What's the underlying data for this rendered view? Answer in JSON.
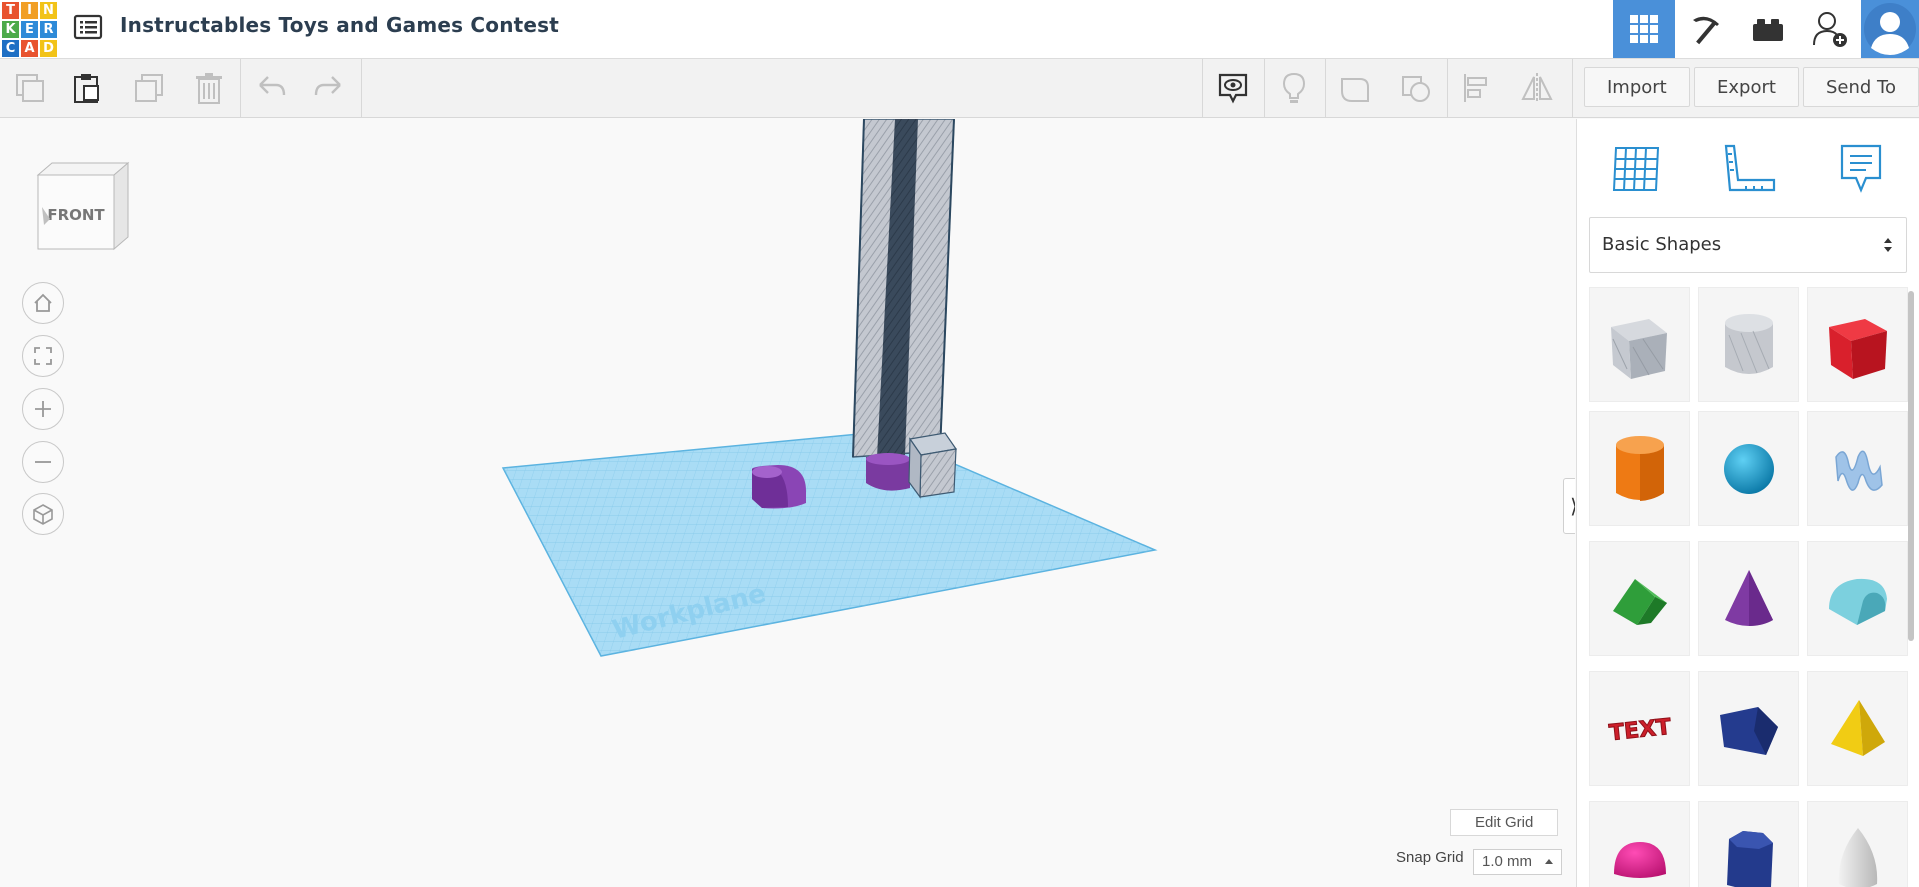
{
  "app": {
    "logo_letters": [
      "T",
      "I",
      "N",
      "K",
      "E",
      "R",
      "C",
      "A",
      "D"
    ],
    "logo_colors": [
      "#e8532f",
      "#f19f26",
      "#f2c318",
      "#4daa4a",
      "#2e8ad8",
      "#2e8ad8",
      "#1e6fc4",
      "#e8532f",
      "#f2c318"
    ],
    "design_title": "Instructables Toys and Games Contest"
  },
  "header": {
    "views": [
      {
        "name": "3d-design-view",
        "icon": "grid-icon",
        "active": true
      },
      {
        "name": "code-blocks-view",
        "icon": "pickaxe-icon",
        "active": false
      },
      {
        "name": "bricks-view",
        "icon": "bricks-icon",
        "active": false
      }
    ],
    "invite_icon": "add-user-icon",
    "accent": "#4a90d9"
  },
  "toolbar": {
    "import_label": "Import",
    "export_label": "Export",
    "send_to_label": "Send To"
  },
  "canvas": {
    "viewcube_label": "FRONT",
    "workplane_label": "Workplane",
    "edit_grid_label": "Edit Grid",
    "snap_grid_label": "Snap Grid",
    "snap_grid_value": "1.0 mm"
  },
  "panel": {
    "shape_category": "Basic Shapes",
    "shapes": [
      {
        "name": "box-hole",
        "color": "#b8bcc4"
      },
      {
        "name": "cylinder-hole",
        "color": "#c4c7cc"
      },
      {
        "name": "box",
        "color": "#d9202c"
      },
      {
        "name": "cylinder",
        "color": "#ee7a14"
      },
      {
        "name": "sphere",
        "color": "#1a9bd0"
      },
      {
        "name": "scribble",
        "color": "#9fc3e8"
      },
      {
        "name": "roof",
        "color": "#2f9e3a"
      },
      {
        "name": "cone",
        "color": "#7f3aa3"
      },
      {
        "name": "round-roof",
        "color": "#5cb8c9"
      },
      {
        "name": "text",
        "color": "#cc1f2a"
      },
      {
        "name": "wedge",
        "color": "#243b8e"
      },
      {
        "name": "pyramid",
        "color": "#f1cc14"
      },
      {
        "name": "half-sphere",
        "color": "#e0198f"
      },
      {
        "name": "polygon",
        "color": "#233a8c"
      },
      {
        "name": "paraboloid",
        "color": "#d9d9d9"
      }
    ],
    "text_shape_label": "TEXT"
  }
}
